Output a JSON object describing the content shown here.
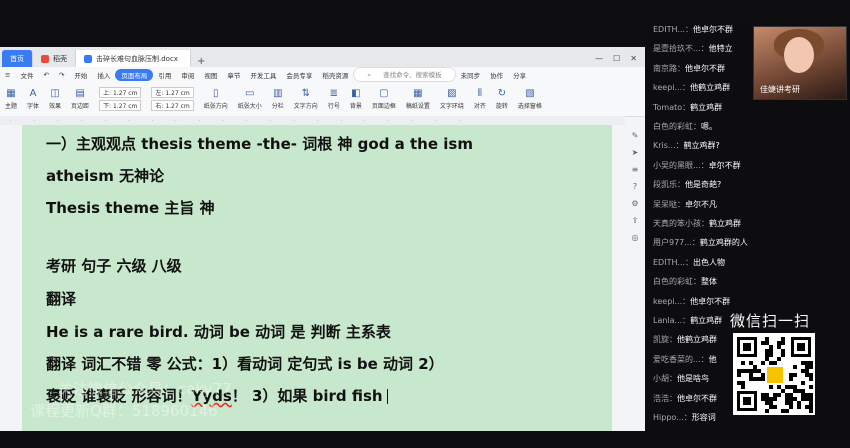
{
  "tabs": {
    "home": "首页",
    "dao": "稻壳",
    "doc": "击碎长难句血脉压制.docx",
    "plus": "+"
  },
  "menu": {
    "file": "文件",
    "items": [
      "开始",
      "插入",
      "页面布局",
      "引用",
      "审阅",
      "视图",
      "章节",
      "开发工具",
      "会员专享",
      "稻壳资源"
    ],
    "active_index": 2,
    "search": "查找命令、搜索模板",
    "right": [
      "未同步",
      "协作",
      "分享"
    ]
  },
  "ribbon": {
    "items": [
      "主题",
      "字体",
      "效果",
      "页边距"
    ],
    "margin_top": "上: 1.27 cm",
    "margin_bottom": "下: 1.27 cm",
    "margin_left": "左: 1.27 cm",
    "margin_right": "右: 1.27 cm",
    "items2": [
      "纸张方向",
      "纸张大小",
      "分栏",
      "文字方向",
      "行号",
      "背景",
      "页面边框",
      "稿纸设置",
      "文字环绕",
      "对齐",
      "旋转",
      "选择窗格"
    ]
  },
  "document": {
    "lines": [
      "一）主观观点  thesis theme      -the- 词根   神   god      a the ism",
      "atheism  无神论",
      "Thesis    theme 主旨    神",
      "考研  句子      六级  八级",
      "翻译",
      "He is a rare bird.      动词    be  动词  是  判断    主系表",
      "翻译    词汇不错    零    公式：1）看动词  定句式     is      be  动词  2）",
      "褒贬     谁褒贬     形容词！",
      "Yyds",
      "！   3）如果  bird    fish"
    ]
  },
  "chat": {
    "messages": [
      {
        "user": "EDITH...：",
        "text": "他卓尔不群"
      },
      {
        "user": "是壹拾玖不...：",
        "text": "他特立"
      },
      {
        "user": "南京路：",
        "text": "他卓尔不群"
      },
      {
        "user": "keepi...：",
        "text": "他鹤立鸡群"
      },
      {
        "user": "Tomato：",
        "text": "鹤立鸡群"
      },
      {
        "user": "白色的彩虹：",
        "text": "嗯。"
      },
      {
        "user": "Kris...：",
        "text": "鹤立鸡群?"
      },
      {
        "user": "小吴的黑眼...：",
        "text": "卓尔不群"
      },
      {
        "user": "段凯乐：",
        "text": "他是奇葩?"
      },
      {
        "user": "呆呆哒：",
        "text": "卓尔不凡"
      },
      {
        "user": "天真的笨小孩：",
        "text": "鹤立鸡群"
      },
      {
        "user": "用户977...：",
        "text": "鹤立鸡群的人"
      },
      {
        "user": "EDITH...：",
        "text": "出色人物"
      },
      {
        "user": "白色的彩虹：",
        "text": "整体"
      },
      {
        "user": "keepi...：",
        "text": "他卓尔不群"
      },
      {
        "user": "Lanla...：",
        "text": "鹤立鸡群"
      },
      {
        "user": "凯旋：",
        "text": "他鹤立鸡群"
      },
      {
        "user": "爱吃香菜的...：",
        "text": "他"
      },
      {
        "user": "小胡：",
        "text": "他是啥鸟"
      },
      {
        "user": "浩浩：",
        "text": "他卓尔不群"
      },
      {
        "user": "Hippo...：",
        "text": "形容词"
      }
    ]
  },
  "streamer_caption": "佳婕讲考研",
  "wechat_label": "微信扫一扫",
  "watermark": {
    "line1": "关注微信公众号：caky77",
    "line2": "课程更新Q群：518960146"
  },
  "colors": {
    "page_bg": "#c7e8cc",
    "accent": "#3a7bf2",
    "chat_bg": "#0d0d10"
  }
}
